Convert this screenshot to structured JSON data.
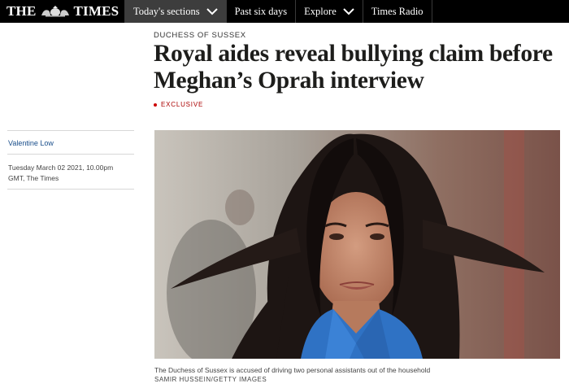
{
  "nav": {
    "logo_left": "THE",
    "logo_right": "TIMES",
    "items": [
      {
        "label": "Today's sections",
        "has_dropdown": true,
        "active": true
      },
      {
        "label": "Past six days",
        "has_dropdown": false,
        "active": false
      },
      {
        "label": "Explore",
        "has_dropdown": true,
        "active": false
      },
      {
        "label": "Times Radio",
        "has_dropdown": false,
        "active": false
      }
    ]
  },
  "article": {
    "section": "DUCHESS OF SUSSEX",
    "headline": "Royal aides reveal bullying claim before Meghan’s Oprah interview",
    "tag": "EXCLUSIVE",
    "author": "Valentine Low",
    "dateline": "Tuesday March 02 2021, 10.00pm GMT, The Times",
    "image": {
      "icon": "portrait-photo",
      "caption": "The Duchess of Sussex is accused of driving two personal assistants out of the household",
      "credit": "SAMIR HUSSEIN/GETTY IMAGES"
    }
  },
  "colors": {
    "nav_bg": "#000000",
    "nav_active": "#3d3d3d",
    "author_link": "#1a4f8b",
    "exclusive": "#aa0000"
  }
}
